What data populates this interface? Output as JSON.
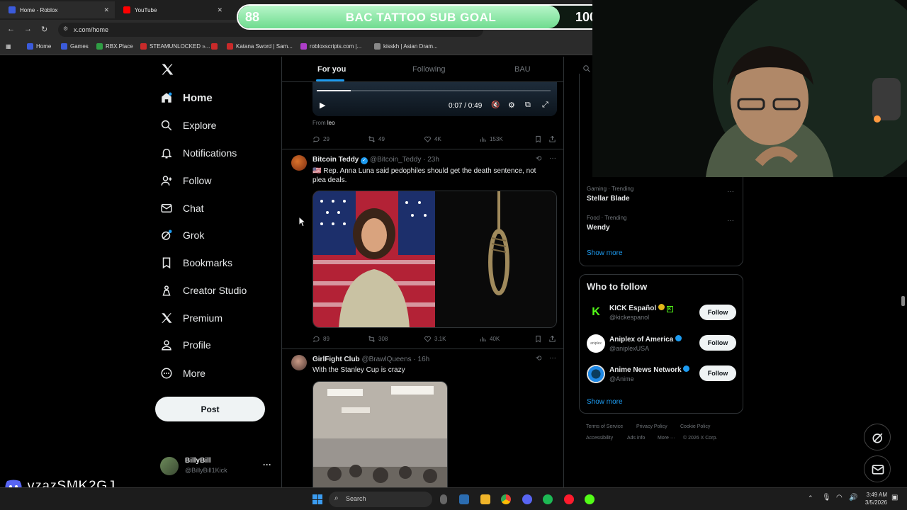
{
  "browser": {
    "tabs": [
      {
        "label": "Home - Roblox",
        "color": "#3b5bdb"
      },
      {
        "label": "YouTube",
        "color": "#ff0000"
      }
    ],
    "url": "x.com/home",
    "bookmarks": [
      {
        "label": "Home",
        "color": "#3b5bdb"
      },
      {
        "label": "Games",
        "color": "#3b5bdb"
      },
      {
        "label": "RBX.Place",
        "color": "#2f9e44"
      },
      {
        "label": "STEAMUNLOCKED »...",
        "color": "#c92a2a"
      },
      {
        "label": "",
        "color": "#c92a2a"
      },
      {
        "label": "Katana Sword | Sam...",
        "color": "#c92a2a"
      },
      {
        "label": "robloxscripts.com |...",
        "color": "#ae3ec9"
      },
      {
        "label": "kisskh | Asian Dram...",
        "color": "#888888"
      }
    ]
  },
  "overlay": {
    "goal_current": "88",
    "goal_title": "BAC TATTOO SUB GOAL",
    "goal_target": "100",
    "goal_progress": 0.88,
    "username": "vzazSMK2GJ"
  },
  "nav": {
    "items": [
      {
        "label": "Home",
        "icon": "home-icon"
      },
      {
        "label": "Explore",
        "icon": "search-icon"
      },
      {
        "label": "Notifications",
        "icon": "bell-icon"
      },
      {
        "label": "Follow",
        "icon": "add-person-icon"
      },
      {
        "label": "Chat",
        "icon": "mail-icon"
      },
      {
        "label": "Grok",
        "icon": "grok-icon"
      },
      {
        "label": "Bookmarks",
        "icon": "bookmark-icon"
      },
      {
        "label": "Creator Studio",
        "icon": "creator-icon"
      },
      {
        "label": "Premium",
        "icon": "x-logo-icon"
      },
      {
        "label": "Profile",
        "icon": "person-icon"
      },
      {
        "label": "More",
        "icon": "more-circle-icon"
      }
    ],
    "post_label": "Post",
    "account": {
      "name": "BillyBill",
      "handle": "@BillyBill1Kick",
      "menu": "···"
    }
  },
  "timeline": {
    "tabs": [
      "For you",
      "Following",
      "BAU"
    ],
    "video": {
      "time": "0:07 / 0:49",
      "from_label": "From",
      "from_name": "leo"
    },
    "first_actions": {
      "replies": "29",
      "reposts": "49",
      "likes": "4K",
      "views": "153K"
    },
    "posts": [
      {
        "name": "Bitcoin Teddy",
        "handle": "@Bitcoin_Teddy",
        "time": "· 23h",
        "text": "🇺🇸 Rep. Anna Luna said pedophiles should get the death sentence, not plea deals.",
        "replies": "89",
        "reposts": "308",
        "likes": "3.1K",
        "views": "40K"
      },
      {
        "name": "GirlFight Club",
        "handle": "@BrawlQueens",
        "time": "· 16h",
        "text": "With the Stanley Cup is crazy"
      }
    ]
  },
  "right": {
    "trends": [
      {
        "meta": "Gaming · Trending",
        "title": "Stellar Blade"
      },
      {
        "meta": "Food · Trending",
        "title": "Wendy"
      }
    ],
    "show_more": "Show more",
    "who_to_follow_title": "Who to follow",
    "follow_suggestions": [
      {
        "name": "KICK Español",
        "handle": "@kickespanol",
        "avatar_color": "#53fc18"
      },
      {
        "name": "Aniplex of America",
        "handle": "@aniplexUSA",
        "avatar_color": "#ffffff"
      },
      {
        "name": "Anime News Network",
        "handle": "@Anime",
        "avatar_color": "#1e88e5"
      }
    ],
    "follow_label": "Follow",
    "footer": [
      "Terms of Service",
      "Privacy Policy",
      "Cookie Policy",
      "Accessibility",
      "Ads info",
      "More ···",
      "© 2026 X Corp."
    ]
  },
  "taskbar": {
    "search_placeholder": "Search",
    "time": "3:49 AM",
    "date": "3/5/2026"
  }
}
